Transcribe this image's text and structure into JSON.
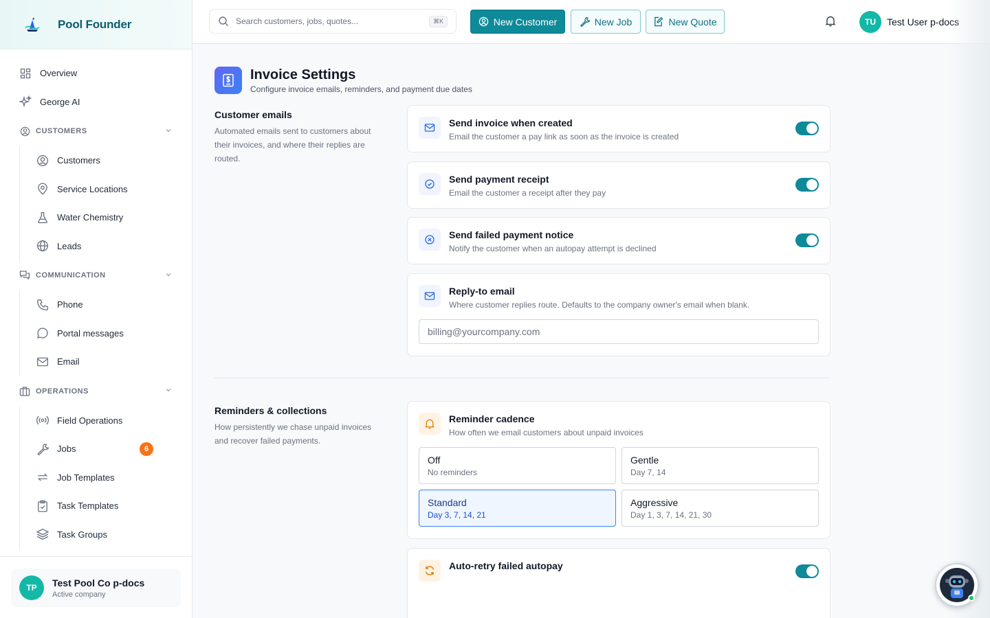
{
  "brand": {
    "name": "Pool Founder"
  },
  "nav": {
    "overview": "Overview",
    "george_ai": "George AI",
    "customers_section": "CUSTOMERS",
    "customers": "Customers",
    "service_locations": "Service Locations",
    "water_chemistry": "Water Chemistry",
    "leads": "Leads",
    "communication_section": "COMMUNICATION",
    "phone": "Phone",
    "portal_messages": "Portal messages",
    "email": "Email",
    "operations_section": "OPERATIONS",
    "field_operations": "Field Operations",
    "jobs": "Jobs",
    "jobs_badge": "6",
    "job_templates": "Job Templates",
    "task_templates": "Task Templates",
    "task_groups": "Task Groups"
  },
  "company": {
    "initials": "TP",
    "name": "Test Pool Co p-docs",
    "status": "Active company"
  },
  "topbar": {
    "search_placeholder": "Search customers, jobs, quotes...",
    "shortcut": "⌘K",
    "new_customer": "New Customer",
    "new_job": "New Job",
    "new_quote": "New Quote",
    "user_initials": "TU",
    "user_name": "Test User p-docs"
  },
  "page": {
    "title": "Invoice Settings",
    "subtitle": "Configure invoice emails, reminders, and payment due dates"
  },
  "customer_emails": {
    "title": "Customer emails",
    "description": "Automated emails sent to customers about their invoices, and where their replies are routed.",
    "send_invoice": {
      "title": "Send invoice when created",
      "desc": "Email the customer a pay link as soon as the invoice is created",
      "enabled": true
    },
    "send_receipt": {
      "title": "Send payment receipt",
      "desc": "Email the customer a receipt after they pay",
      "enabled": true
    },
    "failed_notice": {
      "title": "Send failed payment notice",
      "desc": "Notify the customer when an autopay attempt is declined",
      "enabled": true
    },
    "reply_to": {
      "title": "Reply-to email",
      "desc": "Where customer replies route. Defaults to the company owner's email when blank.",
      "value": "",
      "placeholder": "billing@yourcompany.com"
    }
  },
  "reminders": {
    "title": "Reminders & collections",
    "description": "How persistently we chase unpaid invoices and recover failed payments.",
    "cadence": {
      "title": "Reminder cadence",
      "desc": "How often we email customers about unpaid invoices",
      "selected": "Standard",
      "options": [
        {
          "label": "Off",
          "detail": "No reminders"
        },
        {
          "label": "Gentle",
          "detail": "Day 7, 14"
        },
        {
          "label": "Standard",
          "detail": "Day 3, 7, 14, 21"
        },
        {
          "label": "Aggressive",
          "detail": "Day 1, 3, 7, 14, 21, 30"
        }
      ]
    },
    "auto_retry": {
      "title": "Auto-retry failed autopay",
      "enabled": true
    }
  },
  "colors": {
    "accent": "#0e8a99",
    "brand_text": "#0d5c6e",
    "badge": "#f97316",
    "selected": "#3b82f6"
  }
}
